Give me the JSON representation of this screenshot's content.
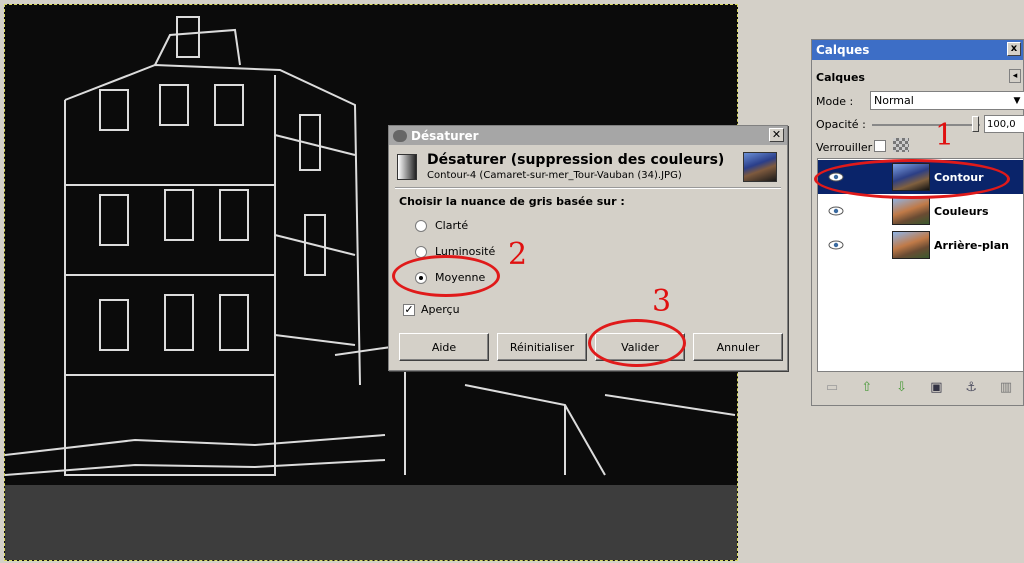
{
  "dialog": {
    "title": "Désaturer",
    "close": "✕",
    "heading": "Désaturer (suppression des couleurs)",
    "subheading": "Contour-4 (Camaret-sur-mer_Tour-Vauban (34).JPG)",
    "prompt": "Choisir la nuance de gris basée sur :",
    "options": [
      {
        "label": "Clarté",
        "checked": false
      },
      {
        "label": "Luminosité",
        "checked": false
      },
      {
        "label": "Moyenne",
        "checked": true
      }
    ],
    "preview_label": "Aperçu",
    "preview_checked": true,
    "buttons": {
      "help": "Aide",
      "reset": "Réinitialiser",
      "ok": "Valider",
      "cancel": "Annuler"
    }
  },
  "layers": {
    "window_title": "Calques",
    "heading": "Calques",
    "mode_label": "Mode :",
    "mode_value": "Normal",
    "opacity_label": "Opacité :",
    "opacity_value": "100,0",
    "lock_label": "Verrouiller :",
    "items": [
      {
        "name": "Contour",
        "selected": true
      },
      {
        "name": "Couleurs",
        "selected": false
      },
      {
        "name": "Arrière-plan",
        "selected": false
      }
    ],
    "footer_icons": [
      "new-layer-icon",
      "raise-layer-icon",
      "lower-layer-icon",
      "duplicate-layer-icon",
      "anchor-layer-icon",
      "delete-layer-icon"
    ]
  },
  "annotations": {
    "n1": "1",
    "n2": "2",
    "n3": "3"
  },
  "colors": {
    "annotation": "#e01010",
    "selection": "#0a246a",
    "titlebar_active": "#3d6ec6"
  }
}
